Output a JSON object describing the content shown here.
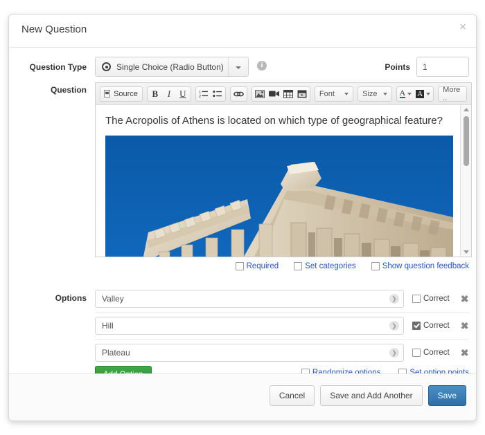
{
  "modal": {
    "title": "New Question",
    "close_label": "×"
  },
  "question_type": {
    "label": "Question Type",
    "selected": "Single Choice (Radio Button)",
    "icon": "radio-button-icon",
    "info_char": "i"
  },
  "points": {
    "label": "Points",
    "value": "1",
    "placeholder": ""
  },
  "question": {
    "label": "Question",
    "text": "The Acropolis of Athens is located on which type of geographical feature?",
    "image_alt": "Parthenon temple columns against blue sky"
  },
  "toolbar": {
    "source": "Source",
    "bold": "B",
    "italic": "I",
    "underline": "U",
    "numbered_list": "numbered-list-icon",
    "bulleted_list": "bulleted-list-icon",
    "link": "link-icon",
    "image": "image-icon",
    "video": "video-icon",
    "table": "table-icon",
    "youtube": "youtube-icon",
    "font": "Font",
    "size": "Size",
    "text_color": "A",
    "bg_color": "A",
    "more": "More .."
  },
  "editor_options": [
    {
      "label": "Required",
      "checked": false,
      "style": "link"
    },
    {
      "label": "Set categories",
      "checked": false,
      "style": "link"
    },
    {
      "label": "Show question feedback",
      "checked": false,
      "style": "link"
    }
  ],
  "options": {
    "label": "Options",
    "correct_label": "Correct",
    "delete_label": "✖",
    "chevron": "❯",
    "items": [
      {
        "value": "Valley",
        "correct": false
      },
      {
        "value": "Hill",
        "correct": true
      },
      {
        "value": "Plateau",
        "correct": false
      }
    ],
    "add_button": "Add Option",
    "footer_checkboxes": [
      {
        "label": "Randomize options",
        "checked": false,
        "style": "link"
      },
      {
        "label": "Set option points",
        "checked": false,
        "style": "link"
      }
    ]
  },
  "footer": {
    "cancel": "Cancel",
    "save_add_another": "Save and Add Another",
    "save": "Save"
  },
  "colors": {
    "primary": "#2f6fa8",
    "success": "#2e8b35",
    "link": "#2255cc",
    "sky": "#0c5ba8",
    "stone": "#d8cbb4"
  }
}
